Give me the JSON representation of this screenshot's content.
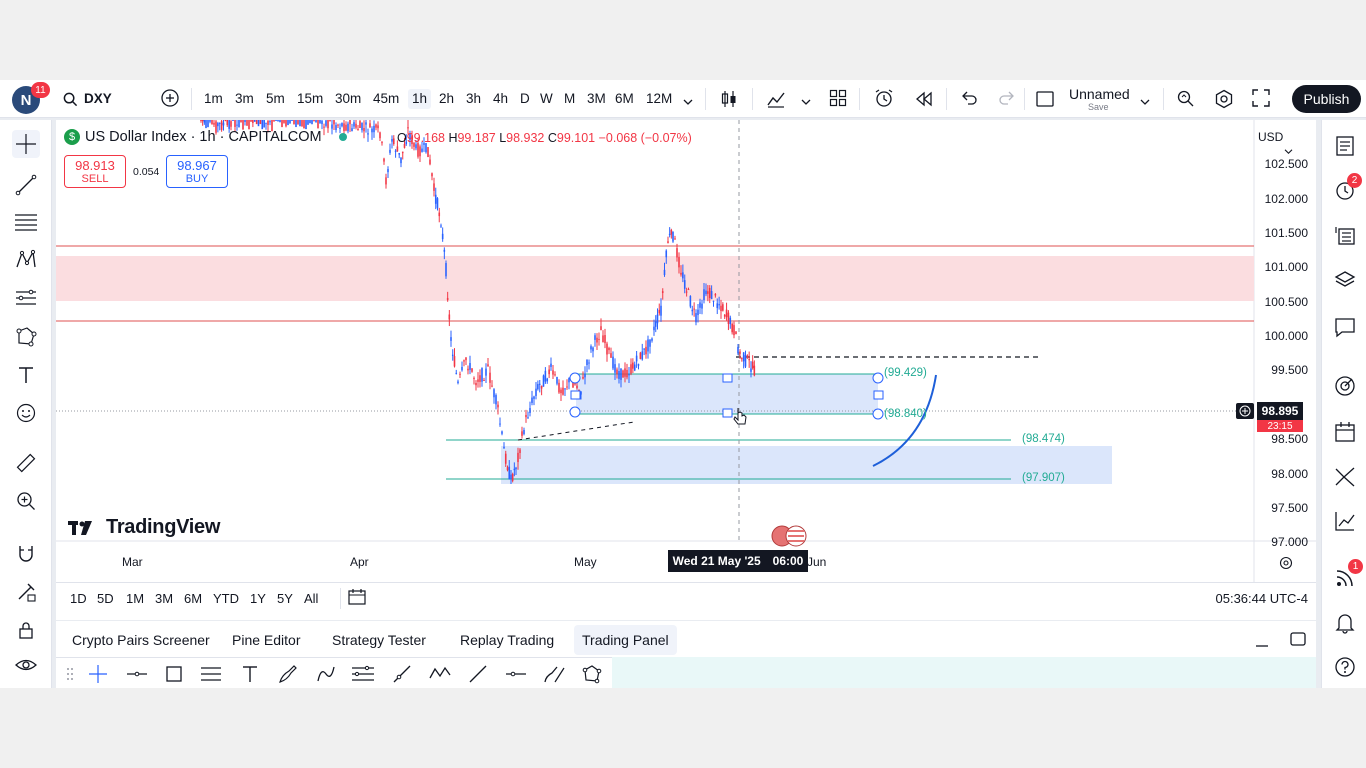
{
  "topbar": {
    "avatar_letter": "N",
    "avatar_badge": "11",
    "symbol": "DXY",
    "intervals": [
      "1m",
      "3m",
      "5m",
      "15m",
      "30m",
      "45m",
      "1h",
      "2h",
      "3h",
      "4h",
      "D",
      "W",
      "M",
      "3M",
      "6M",
      "12M"
    ],
    "active_interval": "1h",
    "layout_name": "Unnamed",
    "layout_sub": "Save",
    "publish": "Publish"
  },
  "chart": {
    "title": "US Dollar Index · 1h · CAPITALCOM",
    "ohlc": {
      "o_label": "O",
      "o": "99.168",
      "h_label": "H",
      "h": "99.187",
      "l_label": "L",
      "l": "98.932",
      "c_label": "C",
      "c": "99.101",
      "change": "−0.068 (−0.07%)"
    },
    "sell_price": "98.913",
    "sell_label": "SELL",
    "spread": "0.054",
    "buy_price": "98.967",
    "buy_label": "BUY",
    "currency": "USD",
    "logo_text": "TradingView",
    "price_ticks": [
      "102.500",
      "102.000",
      "101.500",
      "101.000",
      "100.500",
      "100.000",
      "99.500",
      "98.500",
      "98.000",
      "97.500",
      "97.000"
    ],
    "current_price": "98.895",
    "countdown": "23:15",
    "time_ticks": [
      "Mar",
      "Apr",
      "May",
      "Jun"
    ],
    "crosshair_date": "Wed 21 May '25",
    "crosshair_time": "06:00",
    "levels": [
      "(99.429)",
      "(98.840)",
      "(98.474)",
      "(97.907)"
    ],
    "colors": {
      "up": "#2962ff",
      "down": "#f23645",
      "zone_red": "#fbdde0",
      "zone_blue": "#dbe6fb",
      "level_green": "#22ab94",
      "curve": "#1e5fd9"
    }
  },
  "ranges": {
    "items": [
      "1D",
      "5D",
      "1M",
      "3M",
      "6M",
      "YTD",
      "1Y",
      "5Y",
      "All"
    ],
    "clock": "05:36:44 UTC-4"
  },
  "panel": {
    "tabs": [
      "Crypto Pairs Screener",
      "Pine Editor",
      "Strategy Tester",
      "Replay Trading",
      "Trading Panel"
    ],
    "active_tab": "Trading Panel"
  },
  "right_badges": {
    "alerts": "2",
    "notifications": "1"
  }
}
